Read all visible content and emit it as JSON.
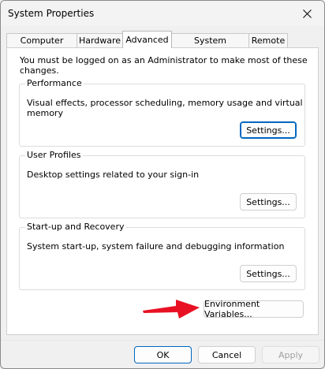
{
  "window": {
    "title": "System Properties"
  },
  "tabs": [
    {
      "label": "Computer Name"
    },
    {
      "label": "Hardware"
    },
    {
      "label": "Advanced"
    },
    {
      "label": "System Protection"
    },
    {
      "label": "Remote"
    }
  ],
  "active_tab": "Advanced",
  "admin_note": "You must be logged on as an Administrator to make most of these changes.",
  "groups": [
    {
      "title": "Performance",
      "description": "Visual effects, processor scheduling, memory usage and virtual memory",
      "button": "Settings..."
    },
    {
      "title": "User Profiles",
      "description": "Desktop settings related to your sign-in",
      "button": "Settings..."
    },
    {
      "title": "Start-up and Recovery",
      "description": "System start-up, system failure and debugging information",
      "button": "Settings..."
    }
  ],
  "env_button": "Environment Variables...",
  "footer": {
    "ok": "OK",
    "cancel": "Cancel",
    "apply": "Apply"
  },
  "colors": {
    "accent": "#0067c0",
    "annotation_arrow": "#e81123"
  },
  "icons": {
    "close": "close-icon",
    "annotation": "red-arrow-icon"
  }
}
